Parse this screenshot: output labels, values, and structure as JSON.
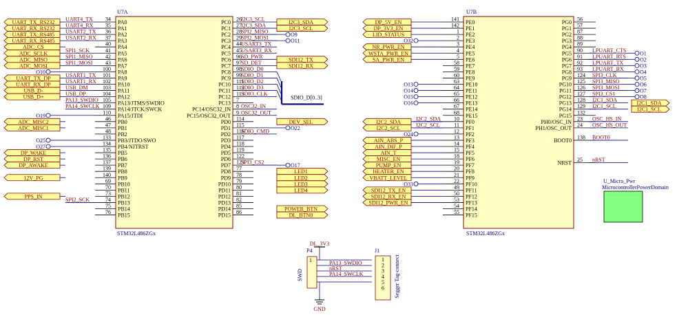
{
  "u7a": {
    "designator": "U7A",
    "part": "STM32L486ZGx",
    "left_pins": [
      {
        "num": "34",
        "name": "PA0",
        "net": "UART4_TX"
      },
      {
        "num": "35",
        "name": "PA1",
        "net": "UART4_RX"
      },
      {
        "num": "36",
        "name": "PA2",
        "net": "USART2_TX"
      },
      {
        "num": "37",
        "name": "PA3",
        "net": "USART2_RX"
      },
      {
        "num": "40",
        "name": "PA4",
        "net": ""
      },
      {
        "num": "41",
        "name": "PA5",
        "net": "SPI1_SCK"
      },
      {
        "num": "42",
        "name": "PA6",
        "net": "SPI1_MISO"
      },
      {
        "num": "43",
        "name": "PA7",
        "net": "SPI1_MOSI"
      },
      {
        "num": "100",
        "name": "PA8",
        "net": ""
      },
      {
        "num": "101",
        "name": "PA9",
        "net": "USART1_TX"
      },
      {
        "num": "102",
        "name": "PA10",
        "net": "USART1_RX"
      },
      {
        "num": "103",
        "name": "PA11",
        "net": "USB_DM"
      },
      {
        "num": "104",
        "name": "PA12",
        "net": "USB_DP"
      },
      {
        "num": "105",
        "name": "PA13/JTMS/SWDIO",
        "net": "PA13_SWDIO"
      },
      {
        "num": "109",
        "name": "PA14/JTCK/SWCK",
        "net": "PA14_SWCLK"
      },
      {
        "num": "110",
        "name": "PA15/JTDI",
        "net": ""
      },
      {
        "num": "46",
        "name": "PB0",
        "net": ""
      },
      {
        "num": "47",
        "name": "PB1",
        "net": ""
      },
      {
        "num": "48",
        "name": "PB2",
        "net": ""
      },
      {
        "num": "133",
        "name": "PB3/JTDO/SWO",
        "net": ""
      },
      {
        "num": "134",
        "name": "PB4/NJTRST",
        "net": ""
      },
      {
        "num": "135",
        "name": "PB5",
        "net": ""
      },
      {
        "num": "136",
        "name": "PB6",
        "net": ""
      },
      {
        "num": "137",
        "name": "PB7",
        "net": ""
      },
      {
        "num": "139",
        "name": "PB8",
        "net": ""
      },
      {
        "num": "140",
        "name": "PB9",
        "net": ""
      },
      {
        "num": "69",
        "name": "PB10",
        "net": ""
      },
      {
        "num": "70",
        "name": "PB11",
        "net": ""
      },
      {
        "num": "73",
        "name": "PB12",
        "net": ""
      },
      {
        "num": "74",
        "name": "PB13",
        "net": "SPI2_SCK"
      },
      {
        "num": "75",
        "name": "PB14",
        "net": ""
      },
      {
        "num": "76",
        "name": "PB15",
        "net": ""
      }
    ],
    "right_pins": [
      {
        "num": "26",
        "name": "PC0",
        "net": "I2C3_SCL"
      },
      {
        "num": "27",
        "name": "PC1",
        "net": "I2C3_SDA"
      },
      {
        "num": "28",
        "name": "PC2",
        "net": "SPI2_MISO"
      },
      {
        "num": "29",
        "name": "PC3",
        "net": "SPI2_MOSI"
      },
      {
        "num": "44",
        "name": "PC4",
        "net": "USART3_TX"
      },
      {
        "num": "45",
        "name": "PC5",
        "net": "USART3_RX"
      },
      {
        "num": "96",
        "name": "PC6",
        "net": "SD_PWR"
      },
      {
        "num": "97",
        "name": "PC7",
        "net": "SD_DET"
      },
      {
        "num": "98",
        "name": "PC8",
        "net": "SDIO_D0"
      },
      {
        "num": "99",
        "name": "PC9",
        "net": "SDIO_D1"
      },
      {
        "num": "111",
        "name": "PC10",
        "net": "SDIO_D2"
      },
      {
        "num": "112",
        "name": "PC11",
        "net": "SDIO_D3"
      },
      {
        "num": "113",
        "name": "PC12",
        "net": "SDIO_CLK"
      },
      {
        "num": "7",
        "name": "PC13",
        "net": ""
      },
      {
        "num": "8",
        "name": "PC14/OSC32_IN",
        "net": "OSC32_IN"
      },
      {
        "num": "9",
        "name": "PC15/OSC32_OUT",
        "net": "OSC32_OUT"
      },
      {
        "num": "114",
        "name": "PD0",
        "net": ""
      },
      {
        "num": "115",
        "name": "PD1",
        "net": ""
      },
      {
        "num": "116",
        "name": "PD2",
        "net": "SDIO_CMD"
      },
      {
        "num": "117",
        "name": "PD3",
        "net": ""
      },
      {
        "num": "118",
        "name": "PD4",
        "net": ""
      },
      {
        "num": "119",
        "name": "PD5",
        "net": ""
      },
      {
        "num": "122",
        "name": "PD6",
        "net": ""
      },
      {
        "num": "123",
        "name": "PD7",
        "net": "SPI3_CS2"
      },
      {
        "num": "77",
        "name": "PD8",
        "net": ""
      },
      {
        "num": "78",
        "name": "PD9",
        "net": ""
      },
      {
        "num": "79",
        "name": "PD10",
        "net": ""
      },
      {
        "num": "80",
        "name": "PD11",
        "net": ""
      },
      {
        "num": "81",
        "name": "PD12",
        "net": ""
      },
      {
        "num": "82",
        "name": "PD13",
        "net": ""
      },
      {
        "num": "85",
        "name": "PD14",
        "net": ""
      },
      {
        "num": "86",
        "name": "PD15",
        "net": ""
      }
    ]
  },
  "u7b": {
    "designator": "U7B",
    "part": "STM32L486ZGx",
    "left_pins": [
      {
        "num": "141",
        "name": "PE0",
        "net": ""
      },
      {
        "num": "142",
        "name": "PE1",
        "net": ""
      },
      {
        "num": "1",
        "name": "PE2",
        "net": ""
      },
      {
        "num": "2",
        "name": "PE3",
        "net": ""
      },
      {
        "num": "3",
        "name": "PE4",
        "net": ""
      },
      {
        "num": "4",
        "name": "PE5",
        "net": ""
      },
      {
        "num": "5",
        "name": "PE6",
        "net": ""
      },
      {
        "num": "58",
        "name": "PE7",
        "net": ""
      },
      {
        "num": "59",
        "name": "PE8",
        "net": ""
      },
      {
        "num": "60",
        "name": "PE9",
        "net": ""
      },
      {
        "num": "63",
        "name": "PE10",
        "net": ""
      },
      {
        "num": "64",
        "name": "PE11",
        "net": ""
      },
      {
        "num": "65",
        "name": "PE12",
        "net": ""
      },
      {
        "num": "66",
        "name": "PE13",
        "net": ""
      },
      {
        "num": "67",
        "name": "PE14",
        "net": ""
      },
      {
        "num": "68",
        "name": "PE15",
        "net": ""
      },
      {
        "num": "10",
        "name": "PF0",
        "net": "I2C2_SDA"
      },
      {
        "num": "11",
        "name": "PF1",
        "net": "I2C2_SCL"
      },
      {
        "num": "12",
        "name": "PF2",
        "net": ""
      },
      {
        "num": "13",
        "name": "PF3",
        "net": ""
      },
      {
        "num": "14",
        "name": "PF4",
        "net": ""
      },
      {
        "num": "15",
        "name": "PF5",
        "net": ""
      },
      {
        "num": "18",
        "name": "PF6",
        "net": ""
      },
      {
        "num": "19",
        "name": "PF7",
        "net": ""
      },
      {
        "num": "20",
        "name": "PF8",
        "net": ""
      },
      {
        "num": "21",
        "name": "PF9",
        "net": ""
      },
      {
        "num": "22",
        "name": "PF10",
        "net": ""
      },
      {
        "num": "49",
        "name": "PF11",
        "net": ""
      },
      {
        "num": "50",
        "name": "PF12",
        "net": ""
      },
      {
        "num": "53",
        "name": "PF13",
        "net": ""
      },
      {
        "num": "54",
        "name": "PF14",
        "net": ""
      },
      {
        "num": "55",
        "name": "PF15",
        "net": ""
      }
    ],
    "right_pins": [
      {
        "num": "56",
        "name": "PG0",
        "net": ""
      },
      {
        "num": "57",
        "name": "PG1",
        "net": ""
      },
      {
        "num": "87",
        "name": "PG2",
        "net": ""
      },
      {
        "num": "88",
        "name": "PG3",
        "net": ""
      },
      {
        "num": "89",
        "name": "PG4",
        "net": ""
      },
      {
        "num": "90",
        "name": "PG5",
        "net": "LPUART_CTS"
      },
      {
        "num": "91",
        "name": "PG6",
        "net": "LPUART_RTS"
      },
      {
        "num": "92",
        "name": "PG7",
        "net": "LPUART_TX"
      },
      {
        "num": "93",
        "name": "PG8",
        "net": "LPUART_RX"
      },
      {
        "num": "124",
        "name": "PG9",
        "net": "SPI3_CLK"
      },
      {
        "num": "125",
        "name": "PG10",
        "net": "SPI3_MISO"
      },
      {
        "num": "126",
        "name": "PG11",
        "net": "SPI3_MOSI"
      },
      {
        "num": "127",
        "name": "PG12",
        "net": "SPI3_CS1"
      },
      {
        "num": "128",
        "name": "PG13",
        "net": "I2C1_SDA"
      },
      {
        "num": "129",
        "name": "PG14",
        "net": "I2C1_SCL"
      },
      {
        "num": "132",
        "name": "PG15",
        "net": ""
      },
      {
        "num": "23",
        "name": "PH0/OSC_IN",
        "net": "OSC_HS_IN"
      },
      {
        "num": "24",
        "name": "PH1/OSC_OUT",
        "net": "OSC_HS_OUT"
      },
      {
        "num": "138",
        "name": "BOOT0",
        "net": "BOOT0"
      },
      {
        "num": "25",
        "name": "NRST",
        "net": "nRST"
      }
    ]
  },
  "u7a_left_ports": [
    {
      "label": "UART_TX_RS232",
      "row": 0
    },
    {
      "label": "UART_RX_RS232",
      "row": 1
    },
    {
      "label": "UART_TX_RS485",
      "row": 2
    },
    {
      "label": "UART_RX_RS485",
      "row": 3
    },
    {
      "label": "ADC_CS",
      "row": 4
    },
    {
      "label": "ADC_SCLK",
      "row": 5
    },
    {
      "label": "ADC_MISO",
      "row": 6
    },
    {
      "label": "ADC_MOSI",
      "row": 7
    },
    {
      "label": "UART_TX_DP",
      "row": 9
    },
    {
      "label": "UART_RX_DP",
      "row": 10
    },
    {
      "label": "USB_D-",
      "row": 11
    },
    {
      "label": "USB_D+",
      "row": 12
    },
    {
      "label": "ADC_MISC2",
      "row": 16
    },
    {
      "label": "ADC_MISC1",
      "row": 17
    },
    {
      "label": "DP_WAKE",
      "row": 21
    },
    {
      "label": "DP_RST",
      "row": 22
    },
    {
      "label": "DP_AWAKE",
      "row": 23
    },
    {
      "label": "12V_PG",
      "row": 25
    },
    {
      "label": "PPS_IN",
      "row": 28
    }
  ],
  "u7a_left_nc": [
    {
      "label": "O10",
      "row": 8
    },
    {
      "label": "O19",
      "row": 15
    },
    {
      "label": "O25",
      "row": 19
    },
    {
      "label": "O27",
      "row": 20
    }
  ],
  "u7a_right_ports": [
    {
      "label": "I2C3_SDA",
      "row": 0
    },
    {
      "label": "I2C3_SCL",
      "row": 1
    },
    {
      "label": "SDI12_TX",
      "row": 6
    },
    {
      "label": "SDI12_RX",
      "row": 7
    },
    {
      "label": "DEV_SEL",
      "row": 16
    },
    {
      "label": "LED1",
      "row": 24
    },
    {
      "label": "LED2",
      "row": 25
    },
    {
      "label": "LED3",
      "row": 26
    },
    {
      "label": "LED4",
      "row": 27
    },
    {
      "label": "POWER_BTN",
      "row": 30
    },
    {
      "label": "DL_BTN0",
      "row": 31
    }
  ],
  "u7a_right_nc": [
    {
      "label": "O9",
      "row": 2
    },
    {
      "label": "O11",
      "row": 3
    },
    {
      "label": "O22",
      "row": 17
    },
    {
      "label": "O17",
      "row": 23
    }
  ],
  "sdio_bus": {
    "label": "SDIO_D[0..3]"
  },
  "u7b_left_ports": [
    {
      "label": "DP_5V_EN",
      "row": 0
    },
    {
      "label": "DP_3V3_EN",
      "row": 1
    },
    {
      "label": "LID_STATUS",
      "row": 2
    },
    {
      "label": "NR_PWR_EN",
      "row": 4
    },
    {
      "label": "WSTA_PWR_EN",
      "row": 5
    },
    {
      "label": "SA_PWR_EN",
      "row": 6
    },
    {
      "label": "I2C2_SDA",
      "row": 16
    },
    {
      "label": "I2C2_SCL",
      "row": 17
    },
    {
      "label": "AIN_ABS_P",
      "row": 19
    },
    {
      "label": "AIN_DIF_P",
      "row": 20
    },
    {
      "label": "AIN_T",
      "row": 21
    },
    {
      "label": "MISC_EN",
      "row": 22
    },
    {
      "label": "PUMP_EN",
      "row": 23
    },
    {
      "label": "HEATER_EN",
      "row": 24
    },
    {
      "label": "VBATT_LEVEL",
      "row": 25
    },
    {
      "label": "SDI12_TX_EN",
      "row": 27
    },
    {
      "label": "SDI12_RX_EN",
      "row": 28
    },
    {
      "label": "SDI12_PWR_EN",
      "row": 29
    }
  ],
  "u7b_left_nc": [
    {
      "label": "O32",
      "row": 3
    },
    {
      "label": "O13",
      "row": 10
    },
    {
      "label": "O14",
      "row": 11
    },
    {
      "label": "O15",
      "row": 12
    },
    {
      "label": "O16",
      "row": 13
    },
    {
      "label": "O24",
      "row": 18
    },
    {
      "label": "O33",
      "row": 26
    }
  ],
  "u7b_right_nc": [
    {
      "label": "O1",
      "row": 5
    },
    {
      "label": "O2",
      "row": 6
    },
    {
      "label": "O3",
      "row": 7
    },
    {
      "label": "O4",
      "row": 8
    },
    {
      "label": "O5",
      "row": 9
    },
    {
      "label": "O6",
      "row": 10
    },
    {
      "label": "O7",
      "row": 11
    },
    {
      "label": "O8",
      "row": 12
    }
  ],
  "u7b_right_ports": [
    {
      "label": "I2C1_SDA",
      "row": 13
    },
    {
      "label": "I2C1_SCL",
      "row": 14
    }
  ],
  "sheet_symbol": {
    "designator": "U_Micro_Pwr",
    "filename": "MicrocontrollerPowerDomain"
  },
  "swd": {
    "p4": "P4",
    "p4_desc": "SWD",
    "power": "DL_3V3",
    "gnd": "GND",
    "nets": [
      "PA13_SWDIO",
      "nRST",
      "PA14_SWCLK"
    ],
    "j1": "J1",
    "j1_desc": "Segger Tag-connect",
    "j1_pins": [
      "1",
      "2",
      "3",
      "4",
      "5",
      "6"
    ],
    "p4_pin": "1"
  },
  "colors": {
    "body_fill": "#ffffc4",
    "body_stroke": "#8b0000",
    "port_fill": "#ffff99",
    "wire": "#000080",
    "sheet_fill": "#80ff80"
  }
}
